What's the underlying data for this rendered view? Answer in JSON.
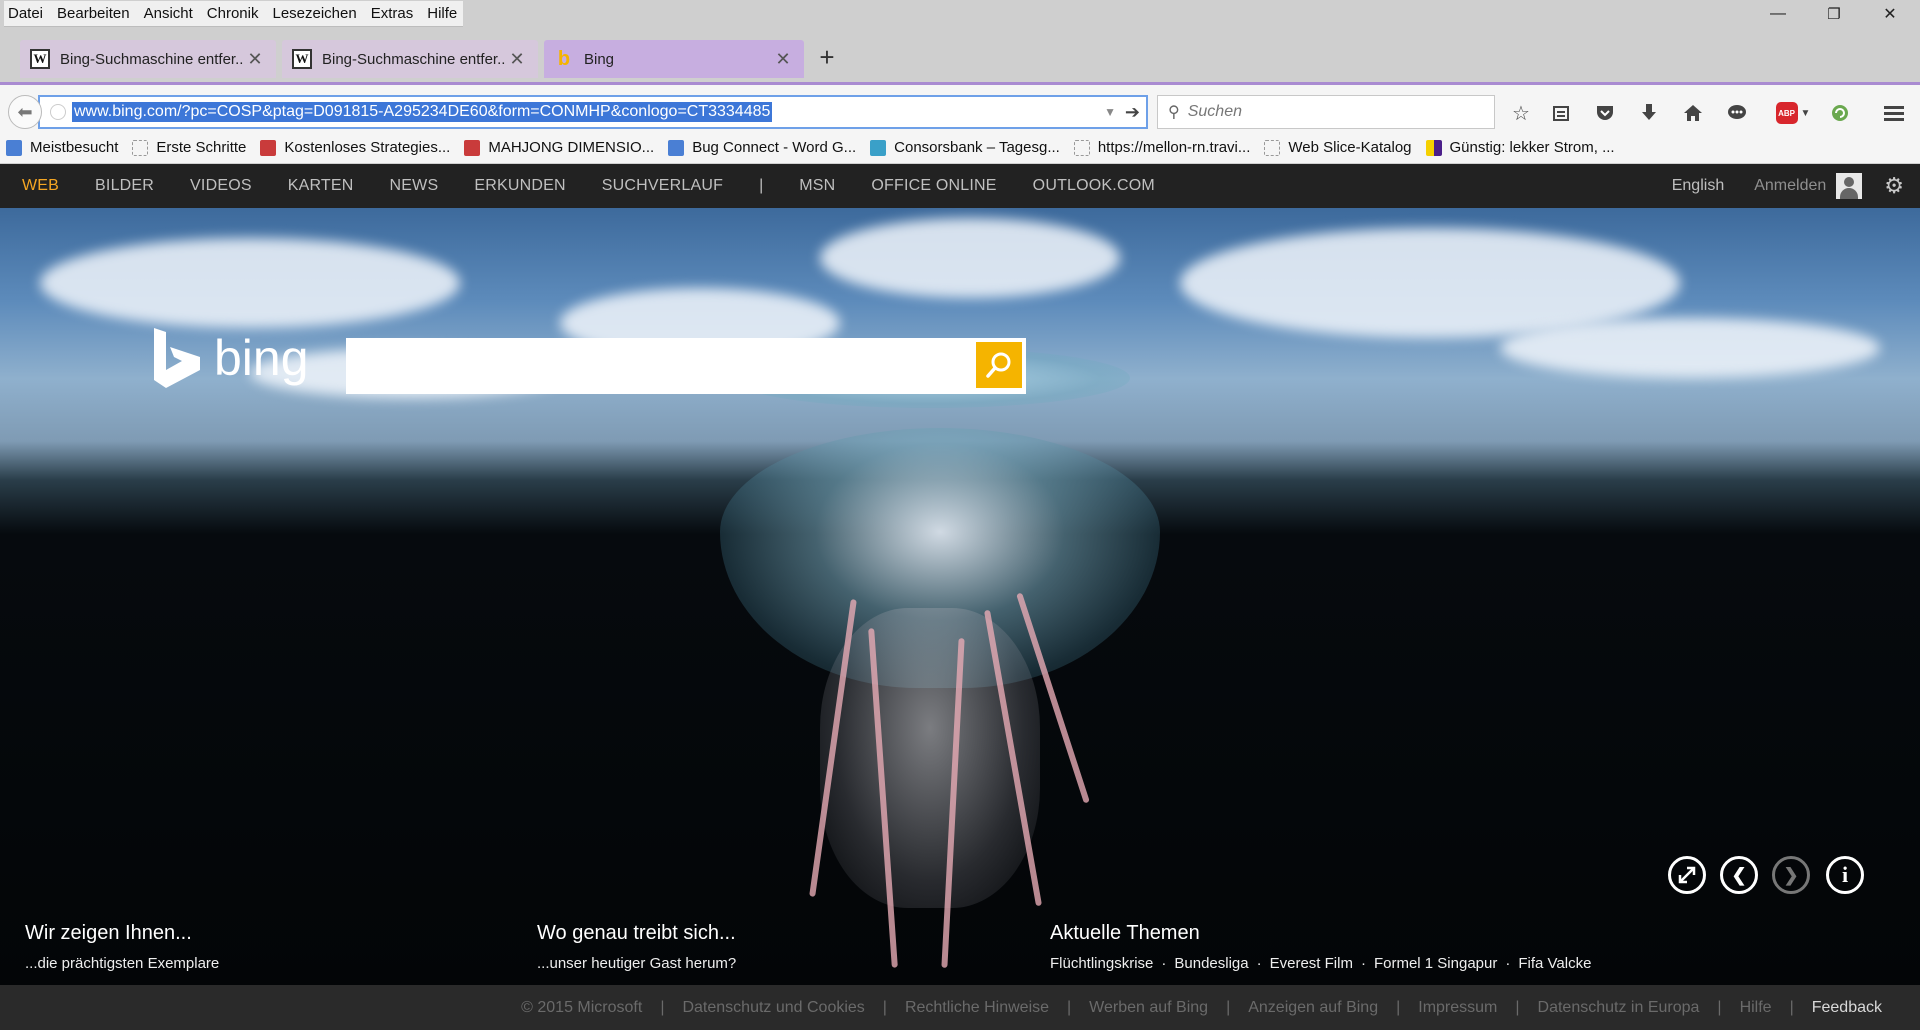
{
  "menu": [
    "Datei",
    "Bearbeiten",
    "Ansicht",
    "Chronik",
    "Lesezeichen",
    "Extras",
    "Hilfe"
  ],
  "window_controls": {
    "minimize": "—",
    "restore": "❐",
    "close": "✕"
  },
  "tabs": [
    {
      "title": "Bing-Suchmaschine entfer...",
      "favicon": "W",
      "active": false
    },
    {
      "title": "Bing-Suchmaschine entfer...",
      "favicon": "W",
      "active": false
    },
    {
      "title": "Bing",
      "favicon": "b",
      "active": true
    }
  ],
  "new_tab": "+",
  "toolbar": {
    "url": "www.bing.com/?pc=COSP&ptag=D091815-A295234DE60&form=CONMHP&conlogo=CT3334485",
    "search_placeholder": "Suchen"
  },
  "bookmarks": [
    {
      "label": "Meistbesucht",
      "icon": "blue"
    },
    {
      "label": "Erste Schritte",
      "icon": "blank"
    },
    {
      "label": "Kostenloses Strategies...",
      "icon": "red"
    },
    {
      "label": "MAHJONG DIMENSIO...",
      "icon": "red"
    },
    {
      "label": "Bug Connect - Word G...",
      "icon": "blue"
    },
    {
      "label": "Consorsbank – Tagesg...",
      "icon": "green"
    },
    {
      "label": "https://mellon-rn.travi...",
      "icon": "blank"
    },
    {
      "label": "Web Slice-Katalog",
      "icon": "blank"
    },
    {
      "label": "Günstig: lekker Strom, ...",
      "icon": "yellow"
    }
  ],
  "bing_nav": {
    "links": [
      "WEB",
      "BILDER",
      "VIDEOS",
      "KARTEN",
      "NEWS",
      "ERKUNDEN",
      "SUCHVERLAUF"
    ],
    "separator": "|",
    "links2": [
      "MSN",
      "OFFICE ONLINE",
      "OUTLOOK.COM"
    ],
    "language": "English",
    "signin": "Anmelden"
  },
  "logo_text": "bing",
  "teasers": [
    {
      "head": "Wir zeigen Ihnen...",
      "sub": "...die prächtigsten Exemplare"
    },
    {
      "head": "Wo genau treibt sich...",
      "sub": "...unser heutiger Gast herum?"
    },
    {
      "head": "Aktuelle Themen"
    }
  ],
  "topics": [
    "Flüchtlingskrise",
    "Bundesliga",
    "Everest Film",
    "Formel 1 Singapur",
    "Fifa Valcke"
  ],
  "footer": [
    "© 2015 Microsoft",
    "Datenschutz und Cookies",
    "Rechtliche Hinweise",
    "Werben auf Bing",
    "Anzeigen auf Bing",
    "Impressum",
    "Datenschutz in Europa",
    "Hilfe",
    "Feedback"
  ],
  "colors": {
    "accent": "#f5b400",
    "active_nav": "#f5a623",
    "tab_active": "#c7aee0",
    "url_select": "#3d77d8"
  }
}
